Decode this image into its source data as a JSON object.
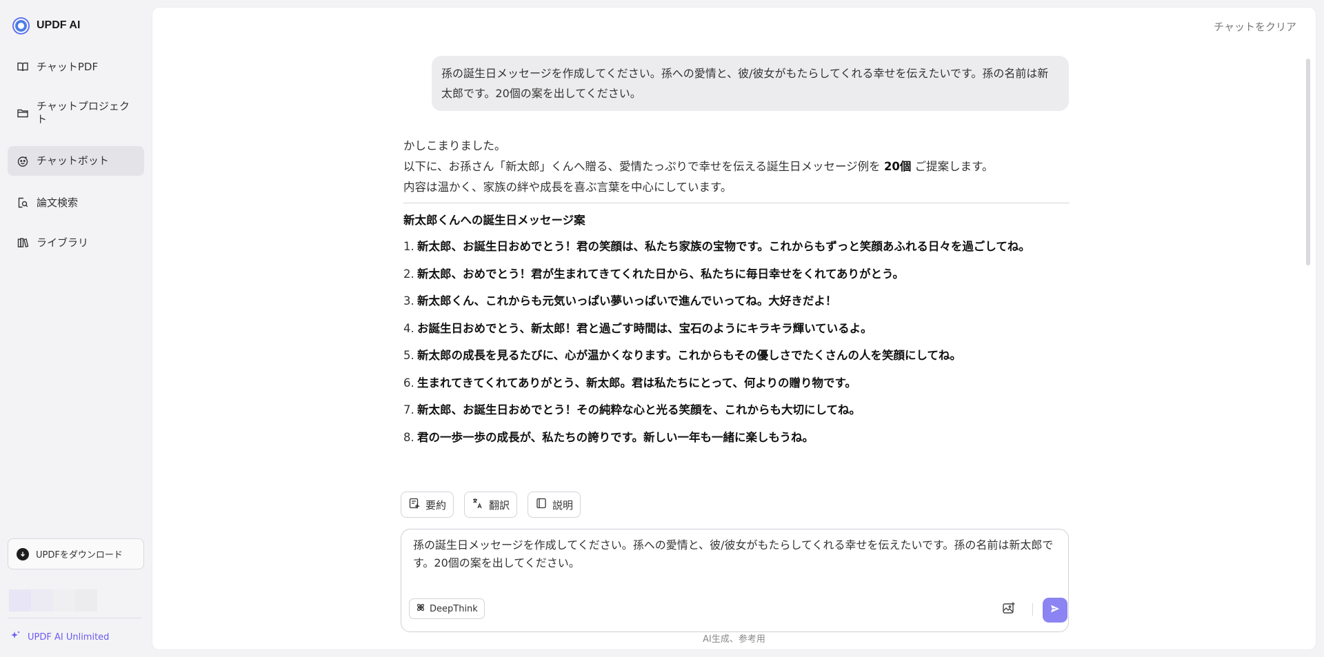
{
  "brand": {
    "name": "UPDF AI",
    "icon": "updf-ai-logo-icon"
  },
  "sidebar": {
    "items": [
      {
        "label": "チャットPDF",
        "icon": "book-open-icon",
        "active": false
      },
      {
        "label": "チャットプロジェクト",
        "icon": "folder-icon",
        "active": false
      },
      {
        "label": "チャットボット",
        "icon": "bot-face-icon",
        "active": true
      },
      {
        "label": "論文検索",
        "icon": "search-document-icon",
        "active": false
      },
      {
        "label": "ライブラリ",
        "icon": "library-icon",
        "active": false
      }
    ],
    "download_label": "UPDFをダウンロード",
    "unlimited_label": "UPDF AI Unlimited"
  },
  "header": {
    "clear_chat": "チャットをクリア"
  },
  "conversation": {
    "user_message": "孫の誕生日メッセージを作成してください。孫への愛情と、彼/彼女がもたらしてくれる幸せを伝えたいです。孫の名前は新太郎です。20個の案を出してください。",
    "answer": {
      "intro_1": "かしこまりました。",
      "intro_2_before": "以下に、お孫さん「新太郎」くんへ贈る、愛情たっぷりで幸せを伝える誕生日メッセージ例を ",
      "intro_2_bold": "20個",
      "intro_2_after": " ご提案します。",
      "intro_3": "内容は温かく、家族の絆や成長を喜ぶ言葉を中心にしています。",
      "heading": "新太郎くんへの誕生日メッセージ案",
      "messages": [
        {
          "num": "1.",
          "text": "新太郎、お誕生日おめでとう！君の笑顔は、私たち家族の宝物です。これからもずっと笑顔あふれる日々を過ごしてね。"
        },
        {
          "num": "2.",
          "text": "新太郎、おめでとう！君が生まれてきてくれた日から、私たちに毎日幸せをくれてありがとう。"
        },
        {
          "num": "3.",
          "text": "新太郎くん、これからも元気いっぱい夢いっぱいで進んでいってね。大好きだよ！"
        },
        {
          "num": "4.",
          "text": "お誕生日おめでとう、新太郎！君と過ごす時間は、宝石のようにキラキラ輝いているよ。"
        },
        {
          "num": "5.",
          "text": "新太郎の成長を見るたびに、心が温かくなります。これからもその優しさでたくさんの人を笑顔にしてね。"
        },
        {
          "num": "6.",
          "text": "生まれてきてくれてありがとう、新太郎。君は私たちにとって、何よりの贈り物です。"
        },
        {
          "num": "7.",
          "text": "新太郎、お誕生日おめでとう！その純粋な心と光る笑顔を、これからも大切にしてね。"
        },
        {
          "num": "8.",
          "text": "君の一歩一歩の成長が、私たちの誇りです。新しい一年も一緒に楽しもうね。"
        }
      ]
    }
  },
  "quick_actions": [
    {
      "label": "要約",
      "icon": "summary-icon"
    },
    {
      "label": "翻訳",
      "icon": "translate-icon"
    },
    {
      "label": "説明",
      "icon": "explain-book-icon"
    }
  ],
  "input": {
    "value": "孫の誕生日メッセージを作成してください。孫への愛情と、彼/彼女がもたらしてくれる幸せを伝えたいです。孫の名前は新太郎です。20個の案を出してください。",
    "deepthink_label": "DeepThink"
  },
  "footer": {
    "disclaimer": "AI生成、参考用"
  },
  "colors": {
    "accent": "#6a5cf0",
    "send_button": "#8b84f2",
    "active_nav": "#e4e4e8"
  }
}
